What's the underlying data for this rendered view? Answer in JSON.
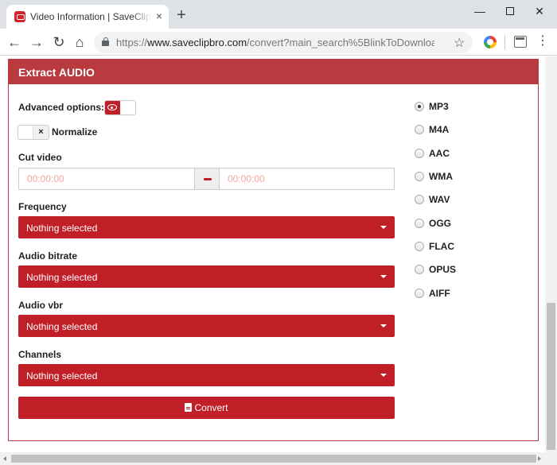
{
  "browser": {
    "tab_title": "Video Information | SaveClipBro",
    "tab_close": "×",
    "new_tab": "+",
    "url_scheme": "https://",
    "url_host": "www.saveclipbro.com",
    "url_path": "/convert?main_search%5BlinkToDownload..."
  },
  "icons": {
    "back": "←",
    "forward": "→",
    "reload": "↻",
    "home": "⌂",
    "star": "☆",
    "menu": "⋮",
    "minimize": "—",
    "close": "✕"
  },
  "panel": {
    "title": "Extract AUDIO",
    "advanced_label": "Advanced options:",
    "normalize_label": "Normalize",
    "normalize_icon": "×",
    "cut_video_label": "Cut video",
    "cut_start_placeholder": "00:00:00",
    "cut_end_placeholder": "00:00:00",
    "fields": [
      {
        "label": "Frequency",
        "value": "Nothing selected"
      },
      {
        "label": "Audio bitrate",
        "value": "Nothing selected"
      },
      {
        "label": "Audio vbr",
        "value": "Nothing selected"
      },
      {
        "label": "Channels",
        "value": "Nothing selected"
      }
    ],
    "convert_label": "Convert"
  },
  "formats": {
    "selected": "MP3",
    "options": [
      "MP3",
      "M4A",
      "AAC",
      "WMA",
      "WAV",
      "OGG",
      "FLAC",
      "OPUS",
      "AIFF"
    ]
  },
  "colors": {
    "header": "#b93a3f",
    "accent": "#c11f28"
  }
}
